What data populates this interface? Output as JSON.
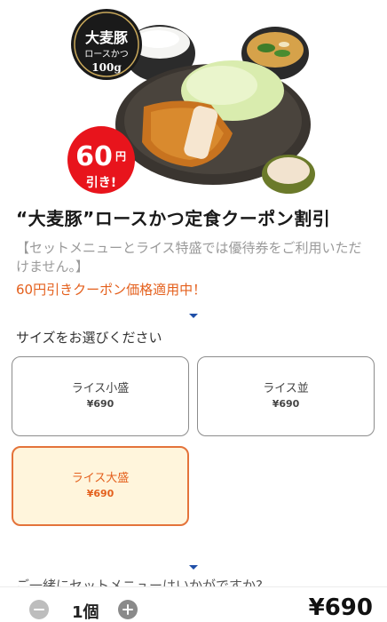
{
  "hero": {
    "badge_line1": "大麦豚",
    "badge_line2": "ロースかつ",
    "badge_line3": "100g",
    "discount_amount": "60",
    "discount_unit": "円",
    "discount_label": "引き!"
  },
  "product": {
    "title": "“大麦豚”ロースかつ定食クーポン割引",
    "notice": "【セットメニューとライス特盛では優待券をご利用いただけません。】",
    "promo": "60円引きクーポン価格適用中！"
  },
  "size_section": {
    "label": "サイズをお選びください",
    "options": [
      {
        "name": "ライス小盛",
        "price": "¥690",
        "selected": false
      },
      {
        "name": "ライス並",
        "price": "¥690",
        "selected": false
      },
      {
        "name": "ライス大盛",
        "price": "¥690",
        "selected": true
      }
    ]
  },
  "upsell": {
    "label": "ご一緒にセットメニューはいかがですか?"
  },
  "footer": {
    "quantity": "1個",
    "total": "¥690"
  },
  "colors": {
    "accent": "#e4601d",
    "selected_bg": "#fff5dc",
    "badge_red": "#e8141c"
  }
}
